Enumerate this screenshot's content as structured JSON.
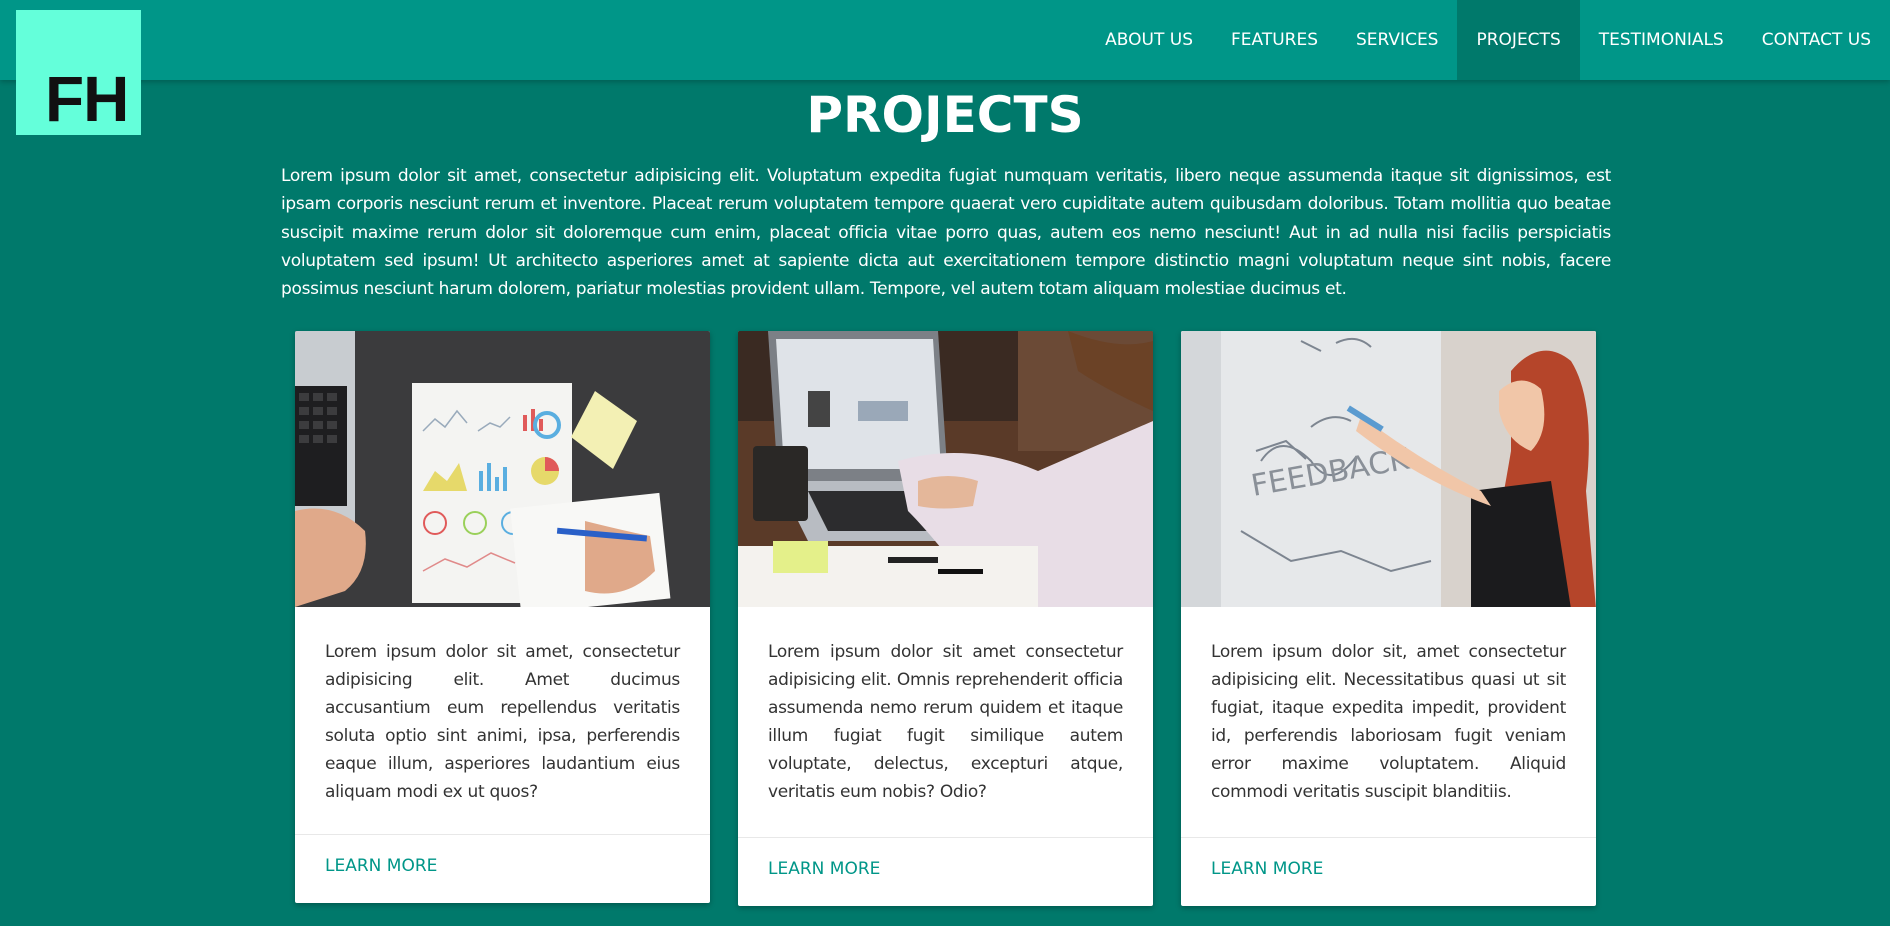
{
  "logo": {
    "text": "FH"
  },
  "nav": {
    "items": [
      {
        "label": "ABOUT US"
      },
      {
        "label": "FEATURES"
      },
      {
        "label": "SERVICES"
      },
      {
        "label": "PROJECTS"
      },
      {
        "label": "TESTIMONIALS"
      },
      {
        "label": "CONTACT US"
      }
    ],
    "active": "PROJECTS"
  },
  "section": {
    "title": "PROJECTS",
    "intro": "Lorem ipsum dolor sit amet, consectetur adipisicing elit. Voluptatum expedita fugiat numquam veritatis, libero neque assumenda itaque sit dignissimos, est ipsam corporis nesciunt rerum et inventore. Placeat rerum voluptatem tempore quaerat vero cupiditate autem quibusdam doloribus. Totam mollitia quo beatae suscipit maxime rerum dolor sit doloremque cum enim, placeat officia vitae porro quas, autem eos nemo nesciunt! Aut in ad nulla nisi facilis perspiciatis voluptatem sed ipsum! Ut architecto asperiores amet at sapiente dicta aut exercitationem tempore distinctio magni voluptatum neque sint nobis, facere possimus nesciunt harum dolorem, pariatur molestias provident ullam. Tempore, vel autem totam aliquam molestiae ducimus et."
  },
  "cards": [
    {
      "image": "photo-laptop-charts-notebook",
      "text": "Lorem ipsum dolor sit amet, consectetur adipisicing elit. Amet ducimus accusantium eum repellendus veritatis soluta optio sint animi, ipsa, perferendis eaque illum, asperiores laudantium eius aliquam modi ex ut quos?",
      "link": "LEARN MORE"
    },
    {
      "image": "photo-typing-on-laptop",
      "text": "Lorem ipsum dolor sit amet consectetur adipisicing elit. Omnis reprehenderit officia assumenda nemo rerum quidem et itaque illum fugiat fugit similique autem voluptate, delectus, excepturi atque, veritatis eum nobis? Odio?",
      "link": "LEARN MORE"
    },
    {
      "image": "photo-woman-writing-whiteboard",
      "text": "Lorem ipsum dolor sit, amet consectetur adipisicing elit. Necessitatibus quasi ut sit fugiat, itaque expedita impedit, provident id, perferendis laboriosam fugit veniam error maxime voluptatem. Aliquid commodi veritatis suscipit blanditiis.",
      "link": "LEARN MORE"
    }
  ],
  "colors": {
    "navbar": "#009688",
    "background": "#00796b",
    "logo_bg": "#64ffda",
    "link": "#009688",
    "card_bg": "#ffffff"
  }
}
